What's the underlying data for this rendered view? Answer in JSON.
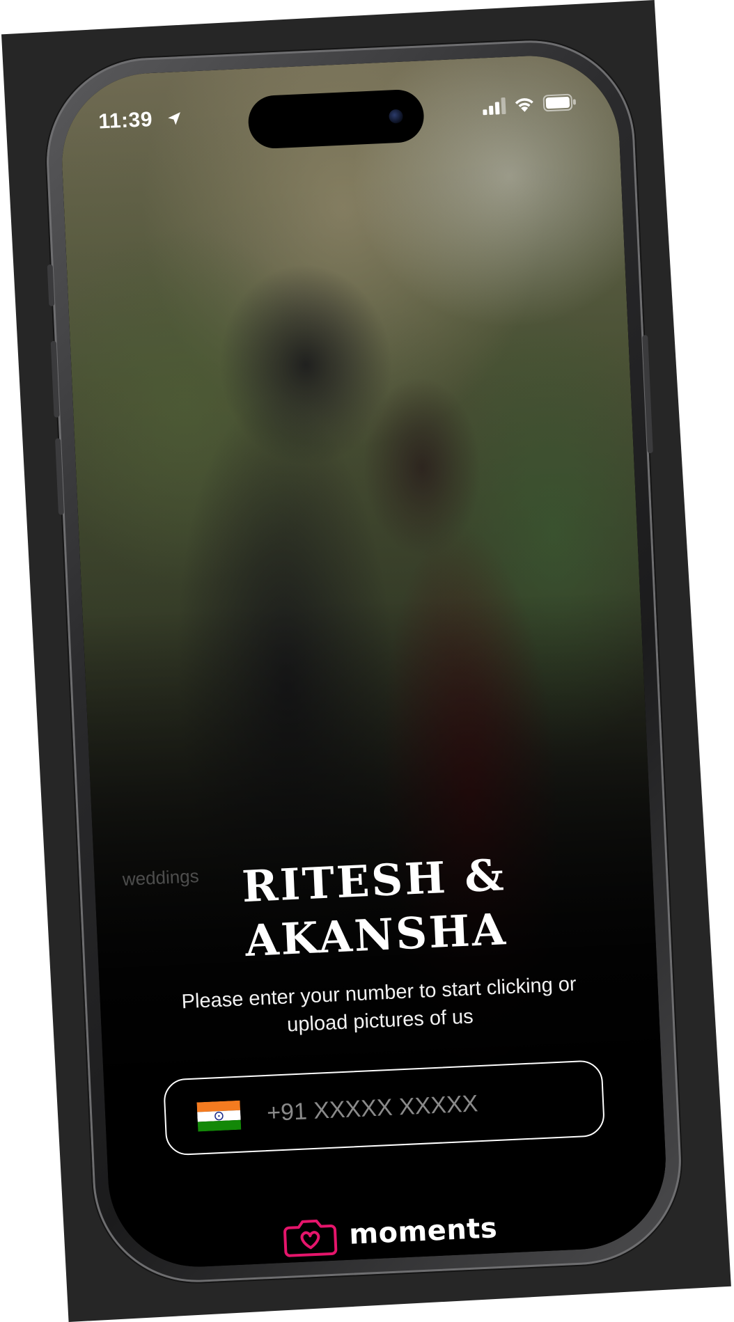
{
  "status_bar": {
    "time": "11:39"
  },
  "hero": {
    "watermark": "weddings",
    "title_line1": "RITESH &",
    "title_line2": "AKANSHA",
    "subtitle_line1": "Please enter your number to start clicking or",
    "subtitle_line2": "upload pictures of us"
  },
  "phone_input": {
    "placeholder": "+91 XXXXX XXXXX",
    "value": "",
    "country_flag": "india-flag-icon"
  },
  "brand": {
    "name": "moments",
    "logo_icon": "camera-heart-icon",
    "accent_color": "#e5156b"
  },
  "icons": {
    "location": "location-arrow-icon",
    "signal": "cellular-signal-icon",
    "wifi": "wifi-icon",
    "battery": "battery-icon"
  }
}
